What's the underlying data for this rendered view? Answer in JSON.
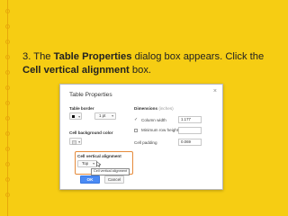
{
  "instruction": {
    "step": "3. The ",
    "bold1": "Table Properties",
    "mid": " dialog box appears. Click the ",
    "bold2": "Cell vertical alignment",
    "end": " box."
  },
  "dialog": {
    "title": "Table Properties",
    "close": "×",
    "table_border_label": "Table border",
    "border_width": "1 pt",
    "cell_bg_label": "Cell background color",
    "cell_valign_label": "Cell vertical alignment",
    "valign_value": "Top",
    "tooltip": "Cell vertical alignment",
    "dimensions_label": "Dimensions",
    "dimensions_unit": "(inches)",
    "column_width_label": "Column width",
    "column_width_value": "1.177",
    "min_row_height_label": "Minimum row height",
    "cell_padding_label": "Cell padding",
    "cell_padding_value": "0.069",
    "ok_label": "OK",
    "cancel_label": "Cancel"
  },
  "colors": {
    "background": "#f6cd13",
    "ok_button": "#4a8af4",
    "highlight": "#e58a3a"
  }
}
